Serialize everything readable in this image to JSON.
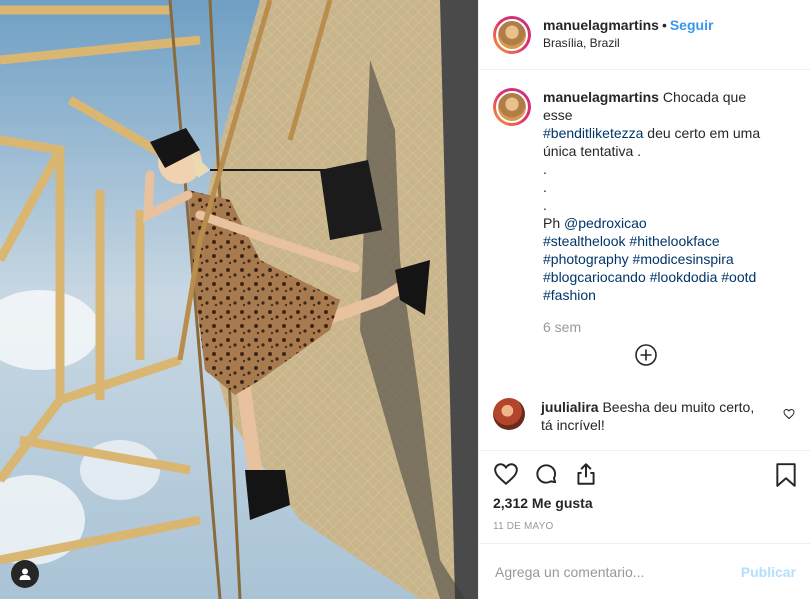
{
  "post": {
    "username": "manuelagmartins",
    "dot": "•",
    "follow_label": "Seguir",
    "location": "Brasília, Brazil",
    "caption": {
      "lines": [
        {
          "parts": [
            {
              "text": "Chocada que esse",
              "tag": false
            }
          ]
        },
        {
          "parts": [
            {
              "text": "#benditliketezza",
              "tag": true
            },
            {
              "text": " deu certo em uma",
              "tag": false
            }
          ]
        },
        {
          "parts": [
            {
              "text": "única tentativa .",
              "tag": false
            }
          ]
        },
        {
          "parts": [
            {
              "text": ".",
              "tag": false
            }
          ]
        },
        {
          "parts": [
            {
              "text": ".",
              "tag": false
            }
          ]
        },
        {
          "parts": [
            {
              "text": ".",
              "tag": false
            }
          ]
        },
        {
          "parts": [
            {
              "text": "Ph ",
              "tag": false
            },
            {
              "text": "@pedroxicao",
              "tag": true
            }
          ]
        },
        {
          "parts": [
            {
              "text": "#stealthelook",
              "tag": true
            },
            {
              "text": " ",
              "tag": false
            },
            {
              "text": "#hithelookface",
              "tag": true
            }
          ]
        },
        {
          "parts": [
            {
              "text": "#photography",
              "tag": true
            },
            {
              "text": " ",
              "tag": false
            },
            {
              "text": "#modicesinspira",
              "tag": true
            }
          ]
        },
        {
          "parts": [
            {
              "text": "#blogcariocando",
              "tag": true
            },
            {
              "text": " ",
              "tag": false
            },
            {
              "text": "#lookdodia",
              "tag": true
            },
            {
              "text": " ",
              "tag": false
            },
            {
              "text": "#ootd",
              "tag": true
            }
          ]
        },
        {
          "parts": [
            {
              "text": "#fashion",
              "tag": true
            }
          ]
        }
      ],
      "time_ago": "6 sem"
    },
    "load_more_icon": "plus-circle-icon",
    "comments": [
      {
        "username": "juulialira",
        "text": "Beesha deu muito certo, tá incrível!"
      }
    ],
    "actions": [
      "heart-icon",
      "comment-icon",
      "share-icon",
      "bookmark-icon"
    ],
    "likes": "2,312 Me gusta",
    "date": "11 DE MAYO",
    "add_comment_placeholder": "Agrega un comentario...",
    "post_button": "Publicar"
  },
  "colors": {
    "link": "#3897f0",
    "hashtag": "#003569",
    "muted": "#999999",
    "post_disabled": "#b2dffc"
  }
}
